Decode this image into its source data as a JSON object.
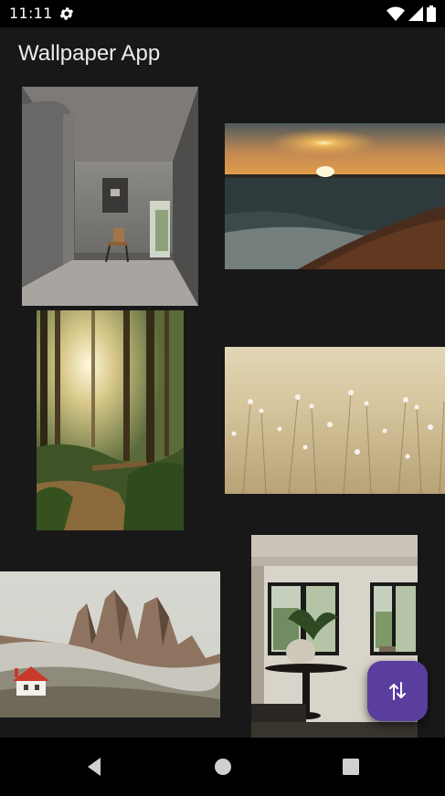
{
  "status_bar": {
    "time": "11:11",
    "icons": [
      "gear-icon",
      "wifi-icon",
      "cellular-icon",
      "battery-icon"
    ]
  },
  "app": {
    "title": "Wallpaper App"
  },
  "gallery": {
    "items": [
      {
        "subject": "minimal concrete interior with chair"
      },
      {
        "subject": "sunset over ocean beach"
      },
      {
        "subject": "sunlit forest path"
      },
      {
        "subject": "field of white wildflowers"
      },
      {
        "subject": "mountain peaks with small red-roof house"
      },
      {
        "subject": "modern dining room with windows"
      }
    ]
  },
  "fab": {
    "icon": "sort-arrows-icon"
  },
  "nav_bar": {
    "icons": [
      "back-icon",
      "home-icon",
      "recents-icon"
    ]
  },
  "colors": {
    "background": "#181818",
    "bars": "#000000",
    "fab": "#5a3e9e"
  }
}
